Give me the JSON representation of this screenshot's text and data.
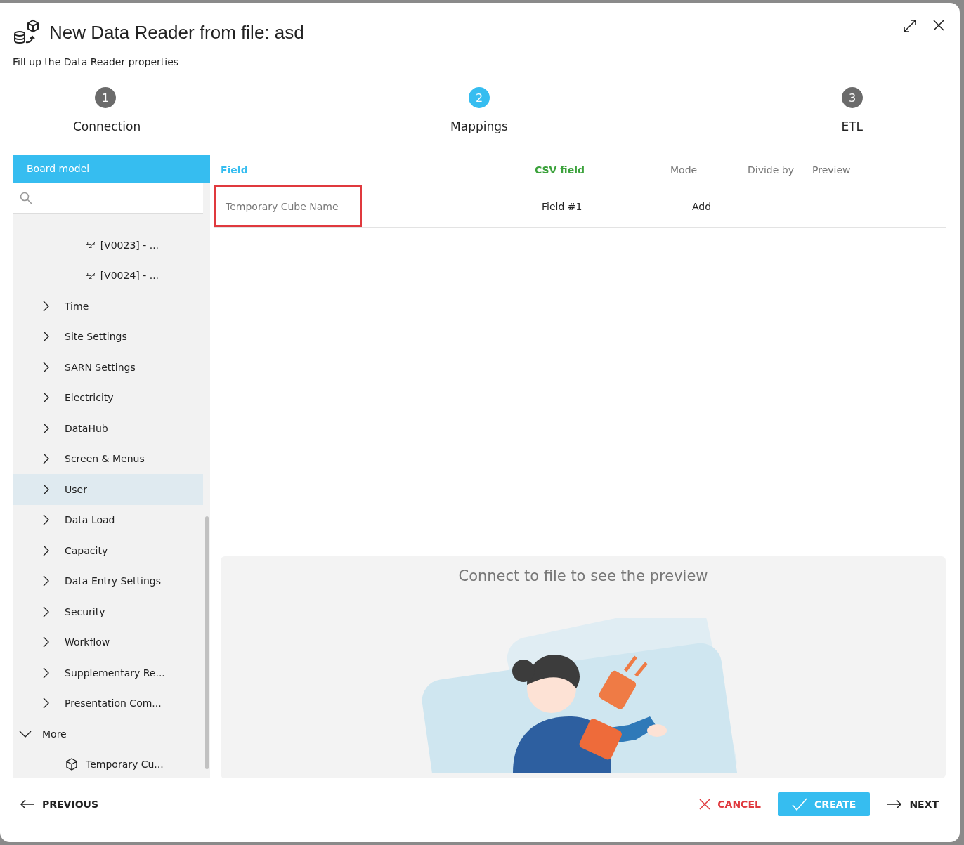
{
  "dialog": {
    "title": "New Data Reader from file: asd",
    "subtitle": "Fill up the Data Reader properties"
  },
  "steps": [
    {
      "number": "1",
      "label": "Connection",
      "selected": false
    },
    {
      "number": "2",
      "label": "Mappings",
      "selected": true
    },
    {
      "number": "3",
      "label": "ETL",
      "selected": false
    }
  ],
  "sidebar": {
    "title": "Board model",
    "items": [
      {
        "kind": "measure",
        "icon": "¹₂³",
        "label": "[V0023] - ...",
        "selected": false
      },
      {
        "kind": "measure",
        "icon": "¹₂³",
        "label": "[V0024] - ...",
        "selected": false
      },
      {
        "kind": "group",
        "label": "Time",
        "expanded": false,
        "selected": false
      },
      {
        "kind": "group",
        "label": "Site Settings",
        "expanded": false,
        "selected": false
      },
      {
        "kind": "group",
        "label": "SARN Settings",
        "expanded": false,
        "selected": false
      },
      {
        "kind": "group",
        "label": "Electricity",
        "expanded": false,
        "selected": false
      },
      {
        "kind": "group",
        "label": "DataHub",
        "expanded": false,
        "selected": false
      },
      {
        "kind": "group",
        "label": "Screen & Menus",
        "expanded": false,
        "selected": false
      },
      {
        "kind": "group",
        "label": "User",
        "expanded": false,
        "selected": true
      },
      {
        "kind": "group",
        "label": "Data Load",
        "expanded": false,
        "selected": false
      },
      {
        "kind": "group",
        "label": "Capacity",
        "expanded": false,
        "selected": false
      },
      {
        "kind": "group",
        "label": "Data Entry Settings",
        "expanded": false,
        "selected": false
      },
      {
        "kind": "group",
        "label": "Security",
        "expanded": false,
        "selected": false
      },
      {
        "kind": "group",
        "label": "Workflow",
        "expanded": false,
        "selected": false
      },
      {
        "kind": "group",
        "label": "Supplementary Re...",
        "expanded": false,
        "selected": false
      },
      {
        "kind": "group",
        "label": "Presentation Com...",
        "expanded": false,
        "selected": false
      },
      {
        "kind": "folder",
        "label": "More",
        "expanded": true,
        "selected": false,
        "children": [
          {
            "kind": "cube",
            "label": "Temporary Cu...",
            "selected": false
          }
        ]
      }
    ]
  },
  "table": {
    "columns": [
      {
        "label": "Field",
        "kind": "field"
      },
      {
        "label": "CSV field",
        "kind": "csv"
      },
      {
        "label": "Mode",
        "kind": "plain"
      },
      {
        "label": "Divide by",
        "kind": "plain"
      },
      {
        "label": "Preview",
        "kind": "plain"
      }
    ],
    "rows": [
      {
        "field": "Temporary Cube Name",
        "csv_field": "Field #1",
        "mode": "Add",
        "selected": true
      }
    ]
  },
  "preview": {
    "message": "Connect to file to see the preview"
  },
  "footer": {
    "previous": "PREVIOUS",
    "cancel": "CANCEL",
    "create": "CREATE",
    "next": "NEXT"
  }
}
